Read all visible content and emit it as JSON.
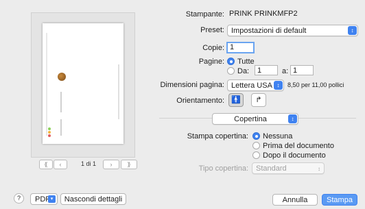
{
  "preview": {
    "page_label": "1 di 1",
    "nav_first": "⟪",
    "nav_prev": "‹",
    "nav_next": "›",
    "nav_last": "⟫"
  },
  "printer": {
    "label": "Stampante:",
    "value": "PRINK PRINKMFP2"
  },
  "preset": {
    "label": "Preset:",
    "value": "Impostazioni di default"
  },
  "copies": {
    "label": "Copie:",
    "value": "1"
  },
  "pages": {
    "label": "Pagine:",
    "all_label": "Tutte",
    "from_label": "Da:",
    "from_value": "1",
    "to_label": "a:",
    "to_value": "1",
    "selected": "all"
  },
  "paper_size": {
    "label": "Dimensioni pagina:",
    "value": "Lettera USA",
    "info": "8,50 per 11,00 pollici"
  },
  "orientation": {
    "label": "Orientamento:",
    "selected": "portrait"
  },
  "section": {
    "value": "Copertina"
  },
  "cover": {
    "label": "Stampa copertina:",
    "options": [
      "Nessuna",
      "Prima del documento",
      "Dopo il documento"
    ],
    "selected_index": 0
  },
  "cover_type": {
    "label": "Tipo copertina:",
    "value": "Standard"
  },
  "footer": {
    "help": "?",
    "pdf": "PDF",
    "hide_details": "Nascondi dettagli",
    "cancel": "Annulla",
    "print": "Stampa"
  },
  "colors": {
    "accent": "#3f82f0",
    "background": "#ececec"
  }
}
